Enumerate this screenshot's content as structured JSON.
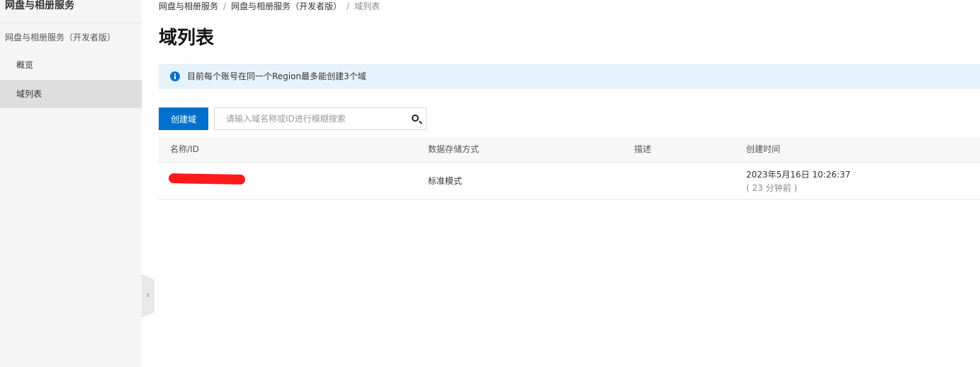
{
  "sidebar": {
    "title": "网盘与相册服务",
    "product": "网盘与相册服务（开发者版）",
    "items": [
      {
        "label": "概览"
      },
      {
        "label": "域列表"
      }
    ]
  },
  "breadcrumb": {
    "items": [
      "网盘与相册服务",
      "网盘与相册服务（开发者版）",
      "域列表"
    ],
    "separator": "/"
  },
  "page": {
    "title": "域列表"
  },
  "notice": {
    "text": "目前每个账号在同一个Region最多能创建3个域",
    "icon": "info-icon"
  },
  "toolbar": {
    "create_label": "创建域",
    "search_placeholder": "请输入域名称或ID进行模糊搜索",
    "search_value": ""
  },
  "table": {
    "columns": [
      "名称/ID",
      "数据存储方式",
      "描述",
      "创建时间"
    ],
    "rows": [
      {
        "name": "",
        "storage": "标准模式",
        "description": "",
        "created": "2023年5月16日 10:26:37",
        "created_relative": "( 23 分钟前 )"
      }
    ]
  },
  "colors": {
    "primary": "#0070cc",
    "notice_bg": "#e6f3fc",
    "sidebar_bg": "#f5f5f5",
    "redaction": "#ff1a1a"
  }
}
